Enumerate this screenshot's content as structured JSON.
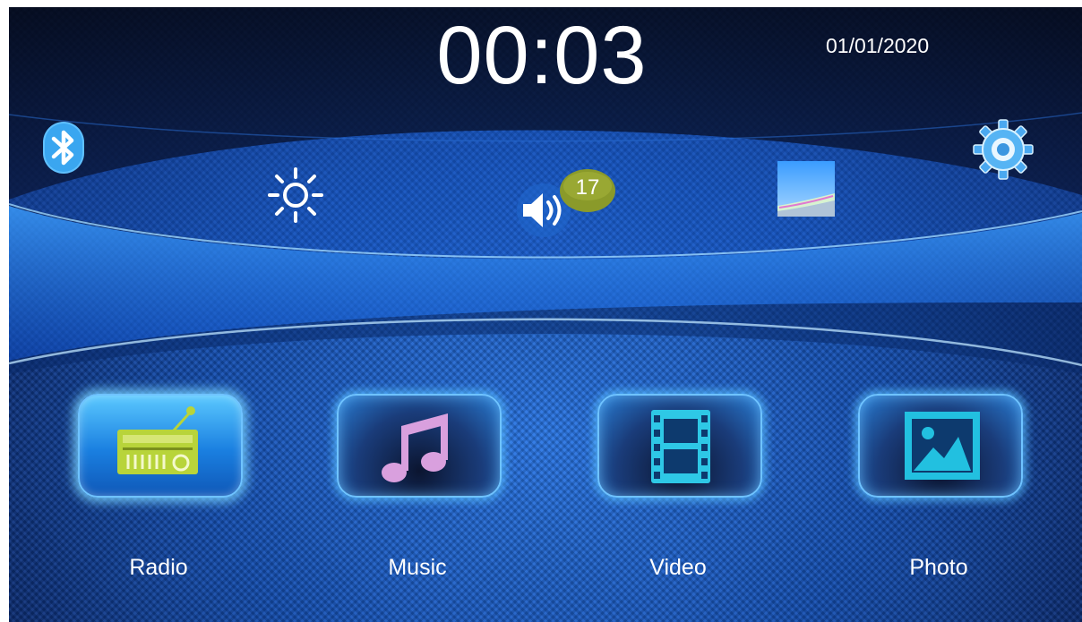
{
  "status": {
    "time": "00:03",
    "date": "01/01/2020"
  },
  "toolbar": {
    "bluetooth_icon": "bluetooth-icon",
    "brightness_icon": "sun-icon",
    "volume_icon": "speaker-icon",
    "volume_level": "17",
    "wallpaper_icon": "wallpaper-icon",
    "settings_icon": "gear-icon"
  },
  "apps": [
    {
      "label": "Radio",
      "icon": "radio-icon",
      "selected": true
    },
    {
      "label": "Music",
      "icon": "music-note-icon",
      "selected": false
    },
    {
      "label": "Video",
      "icon": "film-icon",
      "selected": false
    },
    {
      "label": "Photo",
      "icon": "picture-icon",
      "selected": false
    }
  ],
  "colors": {
    "background": "#1550b4",
    "tile_glow": "#6fc3ff",
    "radio_icon": "#b8d43a",
    "music_icon": "#d9a0de",
    "video_icon": "#2ec8e6",
    "photo_icon": "#22c0e0",
    "volume_badge": "#8a9a2a"
  }
}
